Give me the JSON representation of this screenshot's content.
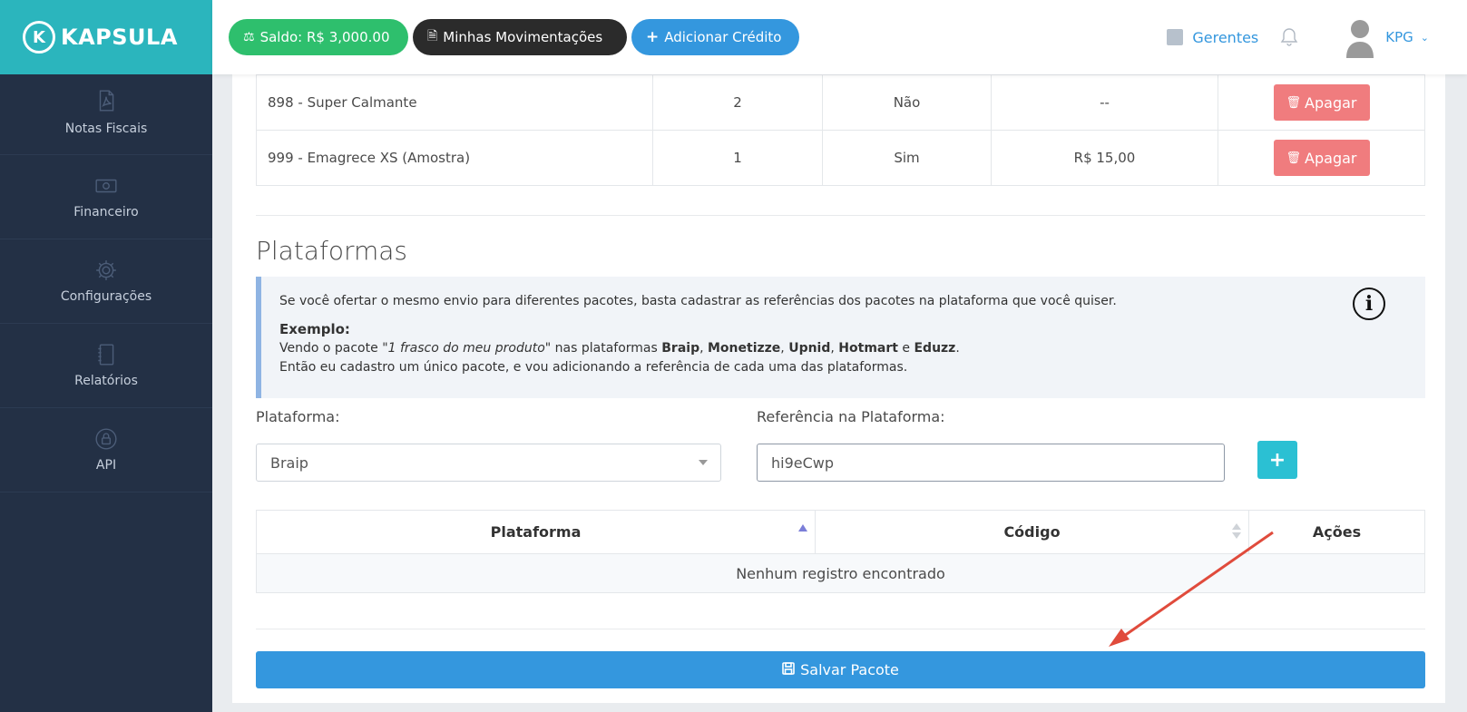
{
  "sidebar": {
    "brand": "KAPSULA",
    "brand_letter": "K",
    "items": [
      {
        "label": "Notas Fiscais",
        "icon": "pdf-file-icon"
      },
      {
        "label": "Financeiro",
        "icon": "money-icon"
      },
      {
        "label": "Configurações",
        "icon": "gear-icon"
      },
      {
        "label": "Relatórios",
        "icon": "notebook-icon"
      },
      {
        "label": "API",
        "icon": "lock-icon"
      }
    ]
  },
  "topbar": {
    "saldo": "Saldo: R$ 3,000.00",
    "movimentacoes": "Minhas Movimentações",
    "adicionar": "Adicionar Crédito",
    "gerentes": "Gerentes",
    "user": "KPG"
  },
  "produtos": [
    {
      "nome": "898 - Super Calmante",
      "qtd": "2",
      "amostra": "Não",
      "valor": "--",
      "acao": "Apagar"
    },
    {
      "nome": "999 - Emagrece XS (Amostra)",
      "qtd": "1",
      "amostra": "Sim",
      "valor": "R$ 15,00",
      "acao": "Apagar"
    }
  ],
  "plataformas": {
    "title": "Plataformas",
    "info_line1": "Se você ofertar o mesmo envio para diferentes pacotes, basta cadastrar as referências dos pacotes na plataforma que você quiser.",
    "exemplo_title": "Exemplo:",
    "ex_vendo": "Vendo o pacote ",
    "ex_quote": "\"1 frasco do meu produto\"",
    "ex_nas": " nas plataformas ",
    "ex_p1": "Braip",
    "ex_p2": "Monetizze",
    "ex_p3": "Upnid",
    "ex_p4": "Hotmart",
    "ex_e": " e ",
    "ex_p5": "Eduzz",
    "ex_line3": "Então eu cadastro um único pacote, e vou adicionando a referência de cada uma das plataformas.",
    "label_plataforma": "Plataforma:",
    "selected_plataforma": "Braip",
    "label_referencia": "Referência na Plataforma:",
    "referencia_value": "hi9eCwp",
    "add_label": "+",
    "table_headers": [
      "Plataforma",
      "Código",
      "Ações"
    ],
    "empty_text": "Nenhum registro encontrado"
  },
  "save_label": "Salvar Pacote",
  "colors": {
    "sidebar": "#233045",
    "brand": "#2bb5bd",
    "primary": "#3497de",
    "success": "#2ebf6d",
    "danger": "#f07c7e",
    "info": "#2bc0d3",
    "annotation_arrow": "#e04b3c"
  }
}
